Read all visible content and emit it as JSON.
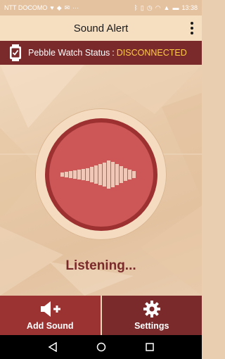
{
  "status_bar": {
    "carrier": "NTT DOCOMO",
    "time": "13:38",
    "left_icons": [
      "heart-icon",
      "notification-icon",
      "mail-icon",
      "more-icon"
    ],
    "right_icons": [
      "bluetooth-icon",
      "vibrate-icon",
      "alarm-icon",
      "wifi-icon",
      "signal-icon",
      "battery-icon"
    ]
  },
  "app_bar": {
    "title": "Sound Alert"
  },
  "pebble": {
    "label": "Pebble Watch Status",
    "separator": ":",
    "state": "DISCONNECTED",
    "state_color": "#ffcc44"
  },
  "main": {
    "status_text": "Listening..."
  },
  "bottom": {
    "add_label": "Add Sound",
    "settings_label": "Settings"
  },
  "colors": {
    "primary_dark": "#7a2a2a",
    "primary": "#9b3333",
    "record": "#cc5756",
    "background": "#e9cfb0"
  }
}
